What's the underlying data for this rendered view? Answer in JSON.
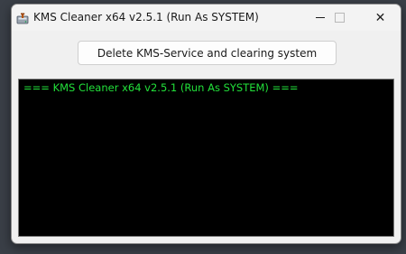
{
  "window": {
    "title": "KMS Cleaner x64 v2.5.1 (Run As SYSTEM)"
  },
  "icons": {
    "app": "disk-cleaner-icon",
    "minimize": "minimize-icon",
    "maximize": "maximize-icon",
    "close": "close-icon"
  },
  "controls": {
    "close_glyph": "✕"
  },
  "main": {
    "action_button_label": "Delete KMS-Service and clearing system"
  },
  "console": {
    "lines": [
      "=== KMS Cleaner x64 v2.5.1 (Run As SYSTEM) ==="
    ],
    "text_color": "#22e03a",
    "background": "#000000"
  }
}
